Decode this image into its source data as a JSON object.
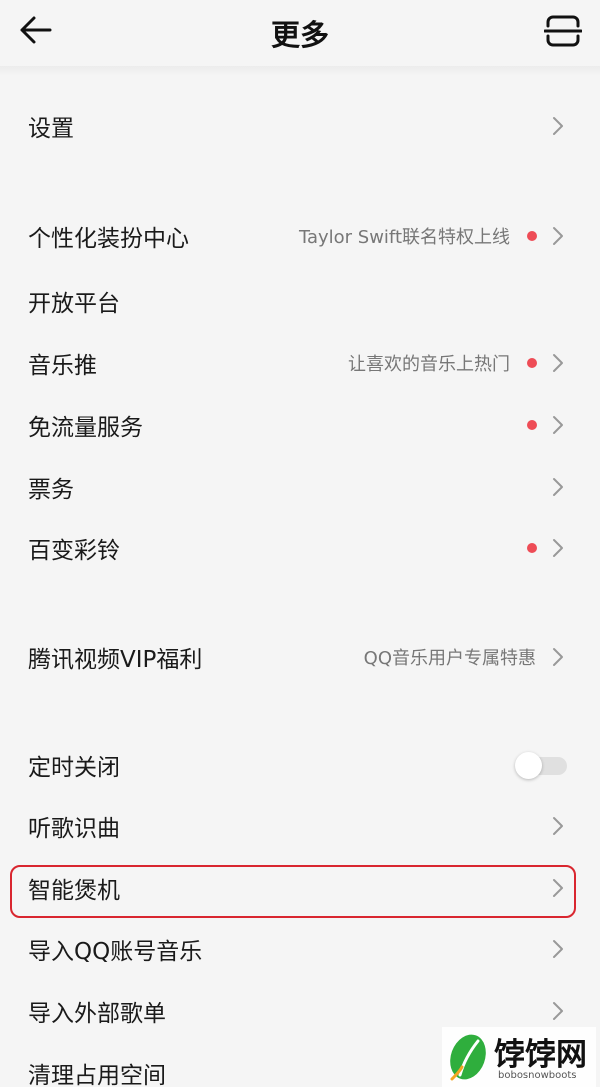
{
  "header": {
    "title": "更多"
  },
  "items": [
    {
      "label": "设置",
      "sub": "",
      "dot": false,
      "control": "chevron"
    },
    {
      "label": "个性化装扮中心",
      "sub": "Taylor Swift联名特权上线",
      "dot": true,
      "control": "chevron"
    },
    {
      "label": "开放平台",
      "sub": "",
      "dot": false,
      "control": "none"
    },
    {
      "label": "音乐推",
      "sub": "让喜欢的音乐上热门",
      "dot": true,
      "control": "chevron"
    },
    {
      "label": "免流量服务",
      "sub": "",
      "dot": true,
      "control": "chevron"
    },
    {
      "label": "票务",
      "sub": "",
      "dot": false,
      "control": "chevron"
    },
    {
      "label": "百变彩铃",
      "sub": "",
      "dot": true,
      "control": "chevron"
    },
    {
      "label": "腾讯视频VIP福利",
      "sub": "QQ音乐用户专属特惠",
      "dot": false,
      "control": "chevron"
    },
    {
      "label": "定时关闭",
      "sub": "",
      "dot": false,
      "control": "toggle",
      "toggle_on": false
    },
    {
      "label": "听歌识曲",
      "sub": "",
      "dot": false,
      "control": "chevron"
    },
    {
      "label": "智能煲机",
      "sub": "",
      "dot": false,
      "control": "chevron",
      "highlighted": true
    },
    {
      "label": "导入QQ账号音乐",
      "sub": "",
      "dot": false,
      "control": "chevron"
    },
    {
      "label": "导入外部歌单",
      "sub": "",
      "dot": false,
      "control": "chevron"
    },
    {
      "label": "清理占用空间",
      "sub": "",
      "dot": false,
      "control": "none"
    }
  ],
  "colors": {
    "background": "#f5f5f5",
    "red_dot": "#ee4c56",
    "highlight_border": "#d9262f",
    "watermark_green": "#2fae3d"
  },
  "icons": {
    "back": "arrow-left-icon",
    "scan": "scan-icon",
    "chevron": "chevron-right-icon"
  },
  "watermark": {
    "text": "饽饽网",
    "url": "bobosnowboots"
  }
}
